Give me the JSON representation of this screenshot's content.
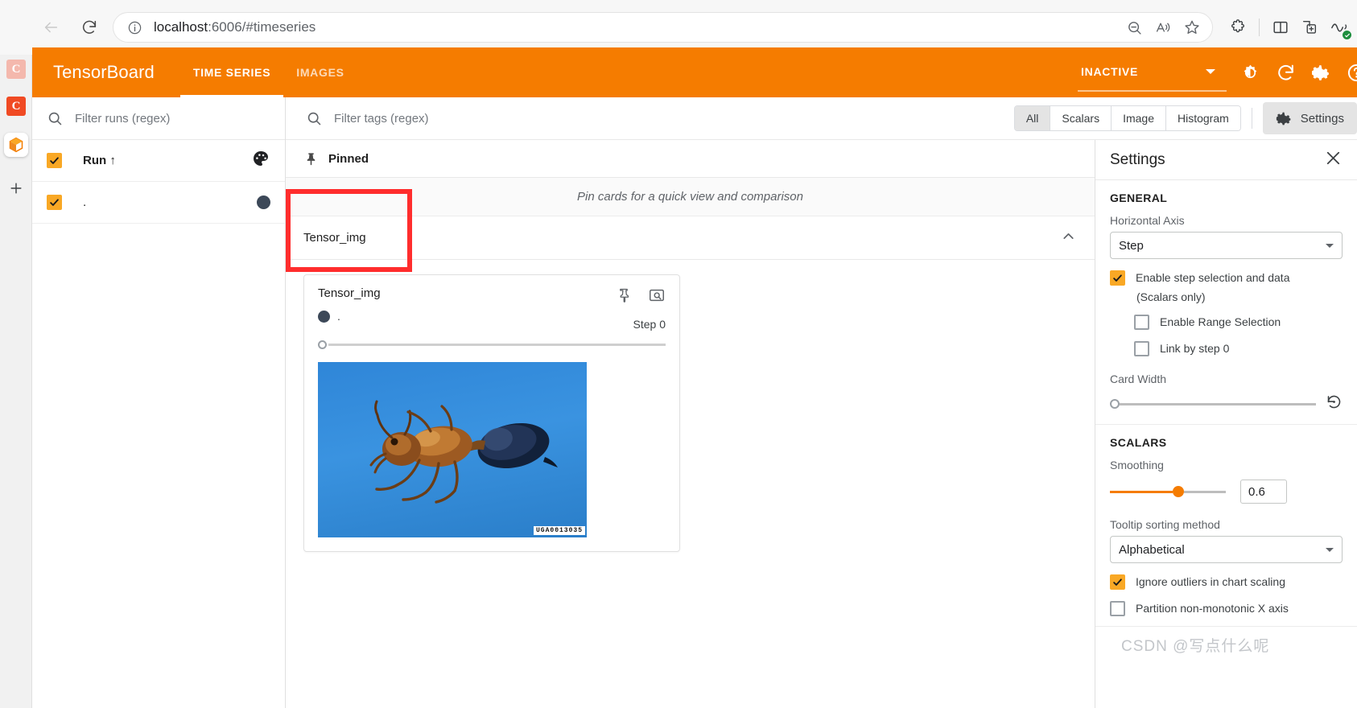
{
  "browser": {
    "url_host": "localhost",
    "url_rest": ":6006/#timeseries",
    "back_icon": "back-arrow-icon",
    "reload_icon": "reload-icon",
    "info_icon": "site-info-icon",
    "zoom_out_icon": "zoom-out-icon",
    "read_aloud_icon": "read-aloud-icon",
    "favorite_icon": "favorite-star-icon",
    "extensions_icon": "extensions-icon",
    "split_screen_icon": "split-screen-icon",
    "collections_icon": "add-to-collections-icon",
    "browser_essentials_icon": "browser-essentials-icon",
    "tabs": [
      {
        "name": "panel-toggle",
        "label": ""
      },
      {
        "name": "tab-favicon-c1",
        "label": "C",
        "color": "#f4b8ad"
      },
      {
        "name": "tab-favicon-c2",
        "label": "C",
        "color": "#f04a23"
      },
      {
        "name": "tab-tensorboard",
        "label": ""
      },
      {
        "name": "new-tab",
        "label": "+"
      }
    ]
  },
  "tensorboard": {
    "brand": "TensorBoard",
    "tabs": [
      {
        "label": "TIME SERIES",
        "active": true
      },
      {
        "label": "IMAGES",
        "active": false
      }
    ],
    "status": "INACTIVE",
    "icons": {
      "dark_mode": "brightness-icon",
      "refresh": "refresh-icon",
      "settings": "settings-gear-icon",
      "help": "help-circle-icon"
    },
    "accent_color": "#f57c00"
  },
  "runs": {
    "search_placeholder": "Filter runs (regex)",
    "header_label": "Run",
    "header_sort_arrow": "↑",
    "palette_icon": "color-palette-icon",
    "items": [
      {
        "label": ".",
        "checked": true,
        "color": "#3c4858"
      }
    ]
  },
  "tagbar": {
    "search_placeholder": "Filter tags (regex)",
    "filters": [
      {
        "label": "All",
        "selected": true
      },
      {
        "label": "Scalars",
        "selected": false
      },
      {
        "label": "Image",
        "selected": false
      },
      {
        "label": "Histogram",
        "selected": false
      }
    ],
    "settings_button": "Settings"
  },
  "main": {
    "pinned_group": "Pinned",
    "pinned_empty_text": "Pin cards for a quick view and comparison",
    "tag_group": "Tensor_img",
    "card": {
      "title": "Tensor_img",
      "run_label": ".",
      "run_color": "#3c4858",
      "step_label": "Step 0",
      "pin_icon": "pin-icon",
      "fullscreen_icon": "image-fullscreen-icon",
      "image_alt": "ant-photograph",
      "image_watermark": "UGA0013035"
    }
  },
  "settings": {
    "title": "Settings",
    "close_icon": "close-icon",
    "general": {
      "heading": "GENERAL",
      "horizontal_axis_label": "Horizontal Axis",
      "horizontal_axis_value": "Step",
      "enable_step_selection": {
        "label": "Enable step selection and data",
        "checked": true
      },
      "scalars_only_note": "(Scalars only)",
      "enable_range_selection": {
        "label": "Enable Range Selection",
        "checked": false
      },
      "link_by_step": {
        "label": "Link by step 0",
        "checked": false
      },
      "card_width_label": "Card Width",
      "card_width_value": 0,
      "reset_icon": "reset-icon"
    },
    "scalars": {
      "heading": "SCALARS",
      "smoothing_label": "Smoothing",
      "smoothing_value": "0.6",
      "smoothing_fraction": 0.6,
      "tooltip_sorting_label": "Tooltip sorting method",
      "tooltip_sorting_value": "Alphabetical",
      "ignore_outliers": {
        "label": "Ignore outliers in chart scaling",
        "checked": true
      },
      "partition_non_monotonic": {
        "label": "Partition non-monotonic X axis",
        "checked": false
      }
    }
  },
  "watermark": "CSDN @写点什么呢"
}
